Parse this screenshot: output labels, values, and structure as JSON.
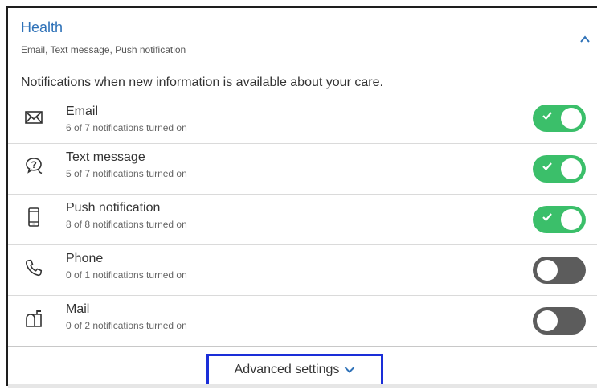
{
  "section": {
    "title": "Health",
    "subtitle": "Email, Text message, Push notification",
    "intro": "Notifications when new information is available about your care."
  },
  "channels": [
    {
      "name": "Email",
      "count": "6 of 7 notifications turned on",
      "icon": "envelope-icon",
      "enabled": true
    },
    {
      "name": "Text message",
      "count": "5 of 7 notifications turned on",
      "icon": "chat-bubble-icon",
      "enabled": true
    },
    {
      "name": "Push notification",
      "count": "8 of 8 notifications turned on",
      "icon": "mobile-phone-icon",
      "enabled": true
    },
    {
      "name": "Phone",
      "count": "0 of 1 notifications turned on",
      "icon": "phone-handset-icon",
      "enabled": false
    },
    {
      "name": "Mail",
      "count": "0 of 2 notifications turned on",
      "icon": "mailbox-icon",
      "enabled": false
    }
  ],
  "footer": {
    "advanced_label": "Advanced settings"
  },
  "colors": {
    "title": "#2f72b8",
    "toggle_on": "#3bbf6a",
    "toggle_off": "#5c5c5c",
    "focus_outline": "#1a2ed8"
  }
}
